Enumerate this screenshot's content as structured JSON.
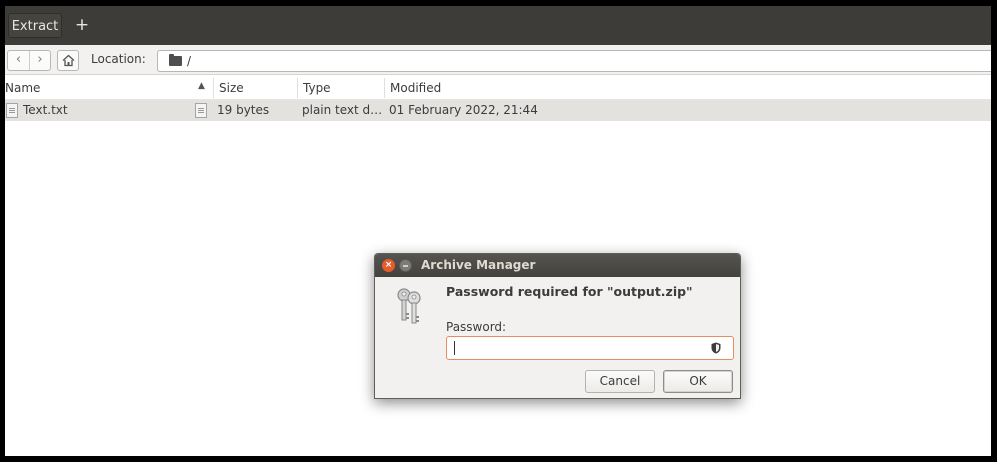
{
  "header": {
    "extract_label": "Extract",
    "add_label": "+"
  },
  "location_bar": {
    "back_glyph": "‹",
    "forward_glyph": "›",
    "label": "Location:",
    "path": "/"
  },
  "file_list": {
    "columns": [
      "Name",
      "Size",
      "Type",
      "Modified"
    ],
    "sort_column": "Name",
    "rows": [
      {
        "name": "Text.txt",
        "size": "19 bytes",
        "type": "plain text d…",
        "modified": "01 February 2022, 21:44"
      }
    ]
  },
  "dialog": {
    "title": "Archive Manager",
    "close_glyph": "×",
    "heading": "Password required for \"output.zip\"",
    "password_label": "Password:",
    "password_value": "",
    "cancel_label": "Cancel",
    "ok_label": "OK",
    "icon": "keys-icon"
  },
  "colors": {
    "headerbar": "#3d3c38",
    "dialog_title": "#4a4945",
    "close_button": "#e45d2a",
    "input_focus_border": "#e98b5e",
    "selected_row": "#e3e2df"
  }
}
